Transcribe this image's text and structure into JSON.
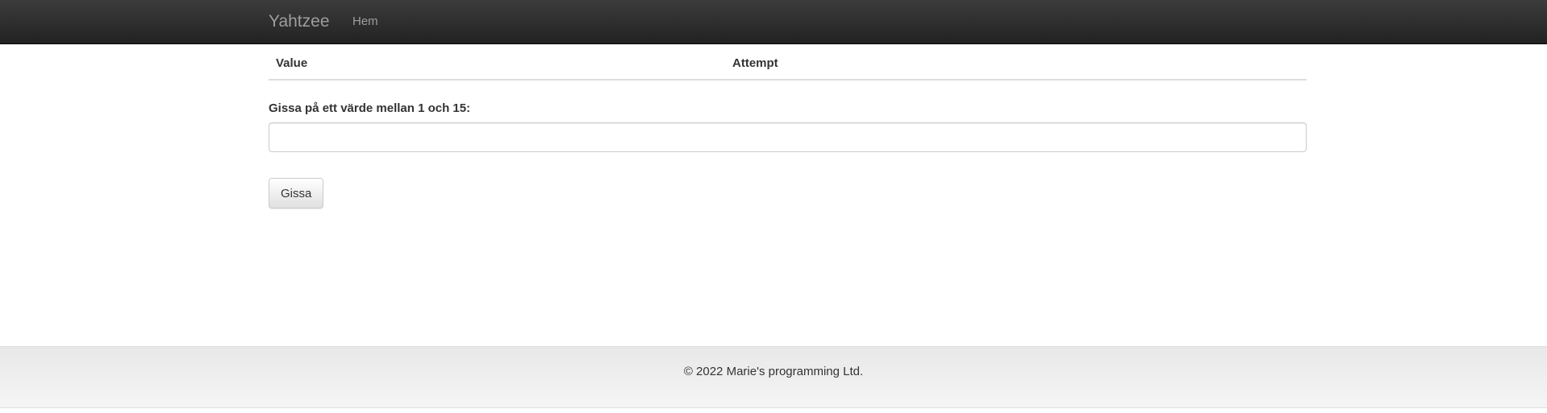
{
  "navbar": {
    "brand": "Yahtzee",
    "links": [
      {
        "label": "Hem"
      }
    ]
  },
  "table": {
    "headers": [
      "Value",
      "Attempt"
    ],
    "rows": []
  },
  "form": {
    "label": "Gissa på ett värde mellan 1 och 15:",
    "input_value": "",
    "input_placeholder": "",
    "submit_label": "Gissa"
  },
  "footer": {
    "text": "© 2022 Marie's programming Ltd."
  },
  "colors": {
    "navbar_bg": "#222222",
    "navbar_text": "#9d9d9d",
    "footer_bg": "#f0f0f0"
  }
}
